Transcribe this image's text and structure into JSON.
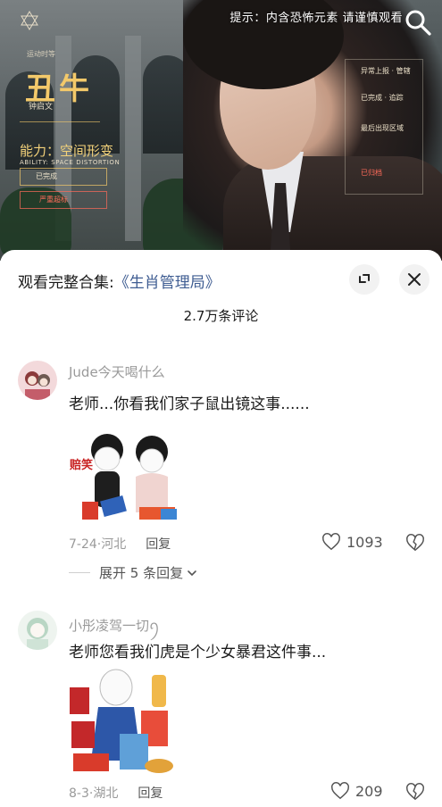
{
  "video": {
    "top_tip": "提示：内含恐怖元素 请谨慎观看",
    "hud": {
      "name_small": "运动时等",
      "title": "丑牛",
      "subtitle": "钟启文",
      "ability": "能力：空间形变",
      "ability_en": "ABILITY: SPACE DISTORTION",
      "status_line": "已完成",
      "warning_line": "严重超标",
      "right_labels": [
        "异常上报 · 管辖",
        "已完成 · 追踪",
        "最后出现区域",
        "已归档"
      ]
    }
  },
  "sheet": {
    "collection_prefix": "观看完整合集:",
    "collection_link": "《生肖管理局》",
    "comment_count": "2.7万条评论"
  },
  "comments": [
    {
      "user": "Jude今天喝什么",
      "text": "老师...你看我们家子鼠出镜这事......",
      "sticker_label": "赔笑",
      "date": "7-24",
      "location": "河北",
      "reply_label": "回复",
      "likes": "1093",
      "expand_label": "展开 5 条回复"
    },
    {
      "user": "小彤凌驾一切ꪆ",
      "text": "老师您看我们虎是个少女暴君这件事...",
      "sticker_label": "",
      "date": "8-3",
      "location": "湖北",
      "reply_label": "回复",
      "likes": "209"
    }
  ],
  "icons": {
    "search": "search-icon",
    "expand": "fullscreen-exit-icon",
    "close": "close-icon",
    "like": "heart-outline-icon",
    "dislike": "broken-heart-icon",
    "chevron": "chevron-down-icon"
  },
  "colors": {
    "link": "#3f5d92",
    "muted": "#9a9a9a",
    "hud_gold": "#f3c96a"
  }
}
